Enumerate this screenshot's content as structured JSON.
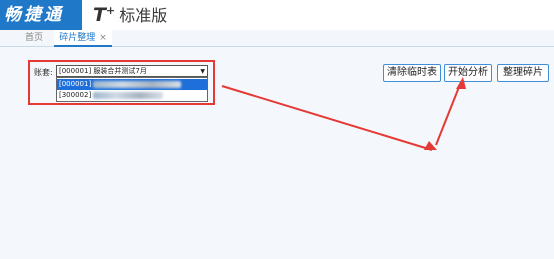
{
  "header": {
    "logo_text": "畅捷通",
    "product_prefix": "T",
    "product_sup": "+",
    "product_name": "标准版"
  },
  "tabs": [
    {
      "label": "首页"
    },
    {
      "label": "碎片整理",
      "close": "×"
    }
  ],
  "form": {
    "ledger_label": "账套:",
    "selected_value": "[000001] 服装合并测试7月",
    "options": [
      {
        "code": "[000001]"
      },
      {
        "code": "[300002]"
      }
    ]
  },
  "buttons": {
    "clear_temp": "清除临时表",
    "start_analysis": "开始分析",
    "defragment": "整理碎片"
  },
  "colors": {
    "brand": "#1f78c8",
    "annotation": "#e53935",
    "selected_option": "#1e6fd9"
  }
}
